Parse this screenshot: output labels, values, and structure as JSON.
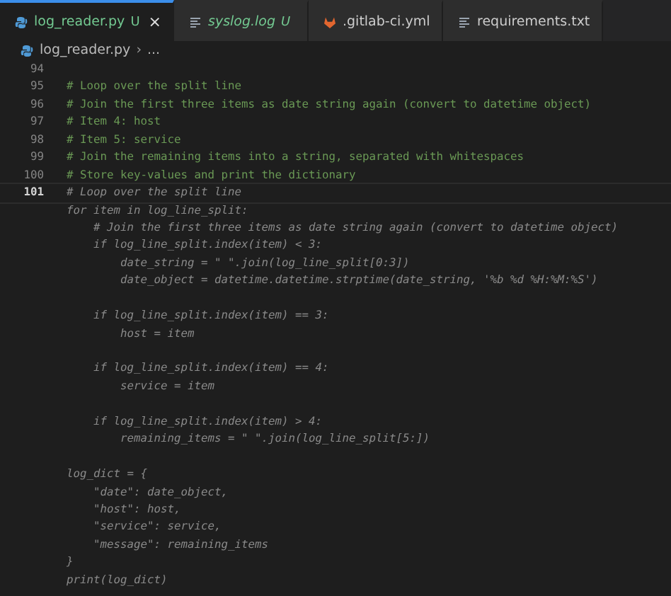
{
  "tabs": [
    {
      "label": "log_reader.py",
      "kind": "python",
      "status": "U",
      "selected": true,
      "preview": false,
      "close": "×"
    },
    {
      "label": "syslog.log",
      "kind": "text",
      "status": "U",
      "selected": false,
      "preview": true
    },
    {
      "label": ".gitlab-ci.yml",
      "kind": "gitlab",
      "selected": false,
      "preview": false
    },
    {
      "label": "requirements.txt",
      "kind": "text",
      "selected": false,
      "preview": false
    }
  ],
  "breadcrumb": {
    "file": "log_reader.py",
    "separator": "›",
    "more": "..."
  },
  "lines": [
    {
      "number": "94",
      "current": false
    },
    {
      "kind": "comment",
      "number": "95",
      "text": "# Loop over the split line",
      "current": false
    },
    {
      "kind": "comment",
      "number": "96",
      "text": "# Join the first three items as date string again (convert to datetime object)",
      "current": false
    },
    {
      "kind": "comment",
      "number": "97",
      "text": "# Item 4: host",
      "current": false
    },
    {
      "kind": "comment",
      "number": "98",
      "text": "# Item 5: service",
      "current": false
    },
    {
      "kind": "comment",
      "number": "99",
      "text": "# Join the remaining items into a string, separated with whitespaces",
      "current": false
    },
    {
      "kind": "comment",
      "number": "100",
      "text": "# Store key-values and print the dictionary",
      "current": false
    },
    {
      "kind": "ghost",
      "number": "101",
      "text": "# Loop over the split line",
      "current": true
    },
    {
      "kind": "ghost",
      "text": "for item in log_line_split:"
    },
    {
      "kind": "ghost",
      "text": "    # Join the first three items as date string again (convert to datetime object)"
    },
    {
      "kind": "ghost",
      "text": "    if log_line_split.index(item) < 3:"
    },
    {
      "kind": "ghost",
      "text": "        date_string = \" \".join(log_line_split[0:3])"
    },
    {
      "kind": "ghost",
      "text": "        date_object = datetime.datetime.strptime(date_string, '%b %d %H:%M:%S')"
    },
    {
      "kind": "ghost",
      "text": "    if log_line_split.index(item) == 3:",
      "blank_line_before": true
    },
    {
      "kind": "ghost",
      "text": "        host = item"
    },
    {
      "kind": "ghost",
      "text": "    if log_line_split.index(item) == 4:",
      "blank_line_before": true
    },
    {
      "kind": "ghost",
      "text": "        service = item"
    },
    {
      "kind": "ghost",
      "text": "    if log_line_split.index(item) > 4:",
      "blank_line_before": true
    },
    {
      "kind": "ghost",
      "text": "        remaining_items = \" \".join(log_line_split[5:])"
    },
    {
      "kind": "ghost",
      "text": "log_dict = {",
      "blank_line_before": true
    },
    {
      "kind": "ghost",
      "text": "    \"date\": date_object,"
    },
    {
      "kind": "ghost",
      "text": "    \"host\": host,"
    },
    {
      "kind": "ghost",
      "text": "    \"service\": service,"
    },
    {
      "kind": "ghost",
      "text": "    \"message\": remaining_items"
    },
    {
      "kind": "ghost",
      "text": "}"
    },
    {
      "kind": "ghost",
      "text": "print(log_dict)"
    }
  ]
}
